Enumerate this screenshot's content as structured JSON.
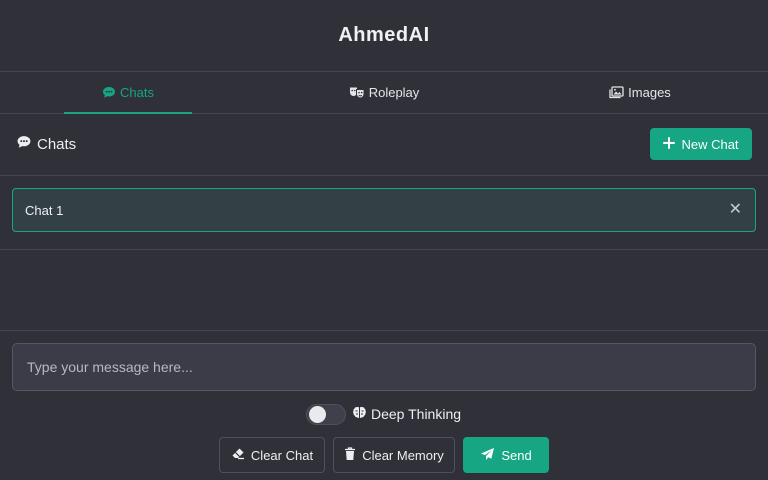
{
  "app": {
    "title": "AhmedAI"
  },
  "tabs": [
    {
      "label": "Chats",
      "icon": "comment-icon",
      "active": true
    },
    {
      "label": "Roleplay",
      "icon": "masks-icon",
      "active": false
    },
    {
      "label": "Images",
      "icon": "images-icon",
      "active": false
    }
  ],
  "section": {
    "title": "Chats",
    "new_chat_label": "New Chat"
  },
  "chats": [
    {
      "name": "Chat 1",
      "selected": true
    }
  ],
  "composer": {
    "placeholder": "Type your message here...",
    "value": "",
    "deep_thinking_label": "Deep Thinking",
    "deep_thinking_enabled": false
  },
  "actions": {
    "clear_chat": "Clear Chat",
    "clear_memory": "Clear Memory",
    "send": "Send"
  },
  "colors": {
    "accent": "#16a683",
    "background": "#2f3038",
    "border": "#454653"
  }
}
